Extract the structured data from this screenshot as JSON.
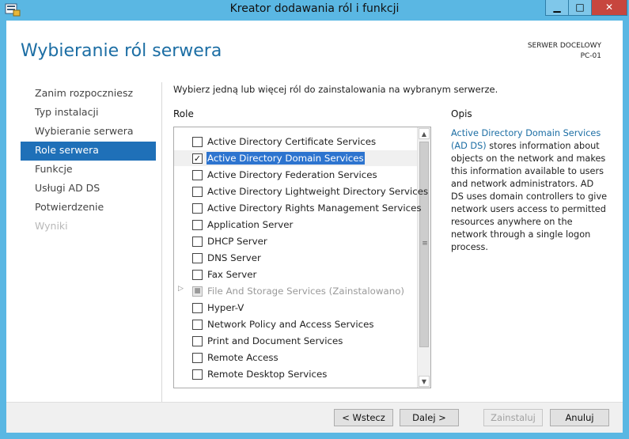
{
  "window": {
    "title": "Kreator dodawania ról i funkcji",
    "buttons": {
      "minimize": "▁",
      "maximize": "□",
      "close": "✕"
    }
  },
  "header": {
    "page_title": "Wybieranie ról serwera",
    "target_label": "SERWER DOCELOWY",
    "target_value": "PC-01"
  },
  "nav": {
    "items": [
      {
        "label": "Zanim rozpoczniesz",
        "state": "normal"
      },
      {
        "label": "Typ instalacji",
        "state": "normal"
      },
      {
        "label": "Wybieranie serwera",
        "state": "normal"
      },
      {
        "label": "Role serwera",
        "state": "active"
      },
      {
        "label": "Funkcje",
        "state": "normal"
      },
      {
        "label": "Usługi AD DS",
        "state": "normal"
      },
      {
        "label": "Potwierdzenie",
        "state": "normal"
      },
      {
        "label": "Wyniki",
        "state": "disabled"
      }
    ]
  },
  "main": {
    "instruction": "Wybierz jedną lub więcej ról do zainstalowania na wybranym serwerze.",
    "roles_header": "Role",
    "description_header": "Opis",
    "roles": [
      {
        "label": "Active Directory Certificate Services",
        "checked": false,
        "selected": false,
        "disabled": false
      },
      {
        "label": "Active Directory Domain Services",
        "checked": true,
        "selected": true,
        "disabled": false
      },
      {
        "label": "Active Directory Federation Services",
        "checked": false,
        "selected": false,
        "disabled": false
      },
      {
        "label": "Active Directory Lightweight Directory Services",
        "checked": false,
        "selected": false,
        "disabled": false
      },
      {
        "label": "Active Directory Rights Management Services",
        "checked": false,
        "selected": false,
        "disabled": false
      },
      {
        "label": "Application Server",
        "checked": false,
        "selected": false,
        "disabled": false
      },
      {
        "label": "DHCP Server",
        "checked": false,
        "selected": false,
        "disabled": false
      },
      {
        "label": "DNS Server",
        "checked": false,
        "selected": false,
        "disabled": false
      },
      {
        "label": "Fax Server",
        "checked": false,
        "selected": false,
        "disabled": false
      },
      {
        "label": "File And Storage Services (Zainstalowano)",
        "checked": true,
        "selected": false,
        "disabled": true,
        "expandable": true
      },
      {
        "label": "Hyper-V",
        "checked": false,
        "selected": false,
        "disabled": false
      },
      {
        "label": "Network Policy and Access Services",
        "checked": false,
        "selected": false,
        "disabled": false
      },
      {
        "label": "Print and Document Services",
        "checked": false,
        "selected": false,
        "disabled": false
      },
      {
        "label": "Remote Access",
        "checked": false,
        "selected": false,
        "disabled": false
      },
      {
        "label": "Remote Desktop Services",
        "checked": false,
        "selected": false,
        "disabled": false
      }
    ],
    "description": {
      "link": "Active Directory Domain Services (AD DS)",
      "text": " stores information about objects on the network and makes this information available to users and network administrators. AD DS uses domain controllers to give network users access to permitted resources anywhere on the network through a single logon process."
    }
  },
  "footer": {
    "back": "< Wstecz",
    "next": "Dalej >",
    "install": "Zainstaluj",
    "cancel": "Anuluj"
  },
  "colors": {
    "accent": "#1f70b8",
    "title_bar": "#5ab7e3",
    "link": "#1c6ea4"
  }
}
